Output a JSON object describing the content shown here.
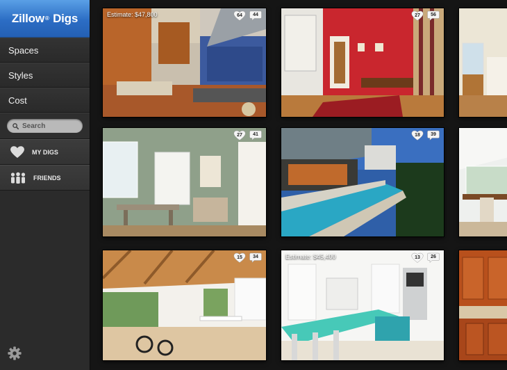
{
  "app": {
    "logo_text": "Zillow",
    "logo_suffix": "Digs",
    "logo_reg": "®"
  },
  "nav": {
    "items": [
      {
        "label": "Spaces"
      },
      {
        "label": "Styles"
      },
      {
        "label": "Cost"
      }
    ]
  },
  "search": {
    "placeholder": "Search"
  },
  "social": {
    "my_digs": "MY DIGS",
    "friends": "FRIENDS"
  },
  "icons": {
    "heart": "heart-icon",
    "friends": "friends-icon",
    "search": "search-icon",
    "settings": "gear-icon",
    "comment": "comment-bubble-icon"
  },
  "colors": {
    "brand_blue": "#2c6dc4",
    "sidebar": "#2b2b2b",
    "background": "#151515"
  },
  "grid": {
    "tiles": [
      {
        "estimate": "Estimate: $47,800",
        "likes": "64",
        "comments": "44"
      },
      {
        "estimate": "",
        "likes": "27",
        "comments": "56"
      },
      {
        "estimate": "",
        "likes": "",
        "comments": ""
      },
      {
        "estimate": "",
        "likes": "27",
        "comments": "41"
      },
      {
        "estimate": "",
        "likes": "18",
        "comments": "39"
      },
      {
        "estimate": "",
        "likes": "",
        "comments": ""
      },
      {
        "estimate": "",
        "likes": "15",
        "comments": "34"
      },
      {
        "estimate": "Estimate: $45,400",
        "likes": "13",
        "comments": "26"
      },
      {
        "estimate": "",
        "likes": "",
        "comments": ""
      }
    ]
  }
}
